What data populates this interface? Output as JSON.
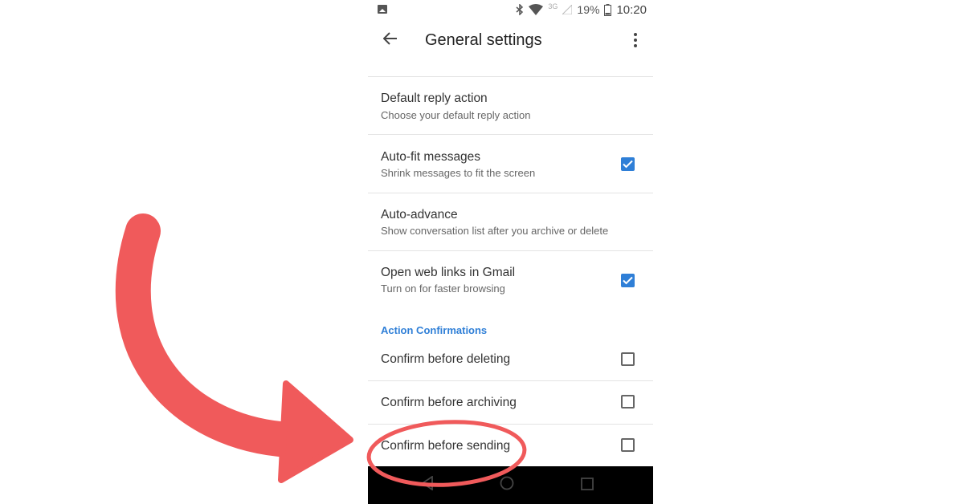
{
  "status_bar": {
    "network_label": "3G",
    "battery_percent": "19%",
    "time": "10:20",
    "icons": [
      "image-icon",
      "bluetooth-icon",
      "wifi-icon",
      "signal-icon",
      "battery-icon"
    ]
  },
  "app_bar": {
    "title": "General settings",
    "back_icon": "arrow-back-icon",
    "menu_icon": "more-vert-icon"
  },
  "settings": [
    {
      "title": "Default reply action",
      "subtitle": "Choose your default reply action",
      "checkbox": null
    },
    {
      "title": "Auto-fit messages",
      "subtitle": "Shrink messages to fit the screen",
      "checkbox": true
    },
    {
      "title": "Auto-advance",
      "subtitle": "Show conversation list after you archive or delete",
      "checkbox": null
    },
    {
      "title": "Open web links in Gmail",
      "subtitle": "Turn on for faster browsing",
      "checkbox": true
    }
  ],
  "section": {
    "header": "Action Confirmations",
    "items": [
      {
        "title": "Confirm before deleting",
        "checked": false
      },
      {
        "title": "Confirm before archiving",
        "checked": false
      },
      {
        "title": "Confirm before sending",
        "checked": false
      }
    ]
  },
  "nav_bar": {
    "icons": [
      "nav-back-icon",
      "nav-home-icon",
      "nav-recents-icon"
    ]
  },
  "colors": {
    "accent": "#2f7fd7",
    "annotation": "#f05a5b",
    "navbar": "#000000"
  }
}
